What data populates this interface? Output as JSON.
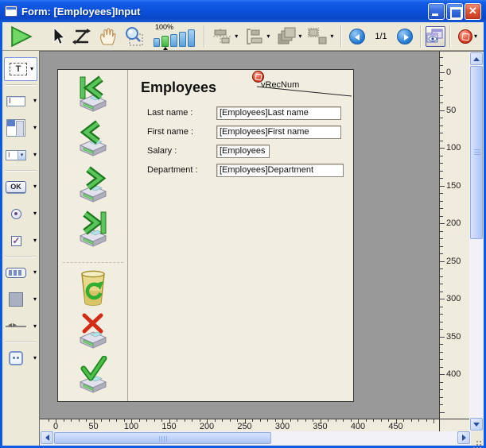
{
  "window": {
    "title": "Form: [Employees]Input"
  },
  "titlebar": {
    "buttons": [
      "minimize",
      "maximize",
      "close"
    ]
  },
  "toolbar": {
    "zoom_value": "100%",
    "page_indicator": "1/1",
    "tools": [
      "execute-form",
      "pointer",
      "entry-order",
      "move",
      "zoom",
      "zoom-scale",
      "align",
      "distribute",
      "move-level",
      "resize",
      "previous-page",
      "next-page",
      "preview",
      "insert-fields"
    ]
  },
  "sidebar": {
    "tools": [
      {
        "name": "text",
        "glyph": "T",
        "active": true
      },
      {
        "name": "input"
      },
      {
        "name": "list-box"
      },
      {
        "name": "combo-box"
      },
      {
        "name": "button",
        "glyph": "OK"
      },
      {
        "name": "radio-button"
      },
      {
        "name": "check-box"
      },
      {
        "name": "button-grid"
      },
      {
        "name": "rectangle"
      },
      {
        "name": "splitter"
      },
      {
        "name": "plugin-area"
      }
    ]
  },
  "form": {
    "title": "Employees",
    "record_variable": "vRecNum",
    "fields": [
      {
        "label": "Last name :",
        "value": "[Employees]Last name"
      },
      {
        "label": "First name :",
        "value": "[Employees]First name"
      },
      {
        "label": "Salary :",
        "value": "[Employees"
      },
      {
        "label": "Department :",
        "value": "[Employees]Department"
      }
    ],
    "nav_buttons": [
      "first-record",
      "previous-record",
      "next-record",
      "last-record",
      "delete-record",
      "cancel-record",
      "accept-record"
    ]
  },
  "rulers": {
    "horizontal_labels": [
      0,
      50,
      100,
      150,
      200,
      250,
      300,
      350,
      400,
      450
    ],
    "vertical_labels": [
      0,
      50,
      100,
      150,
      200,
      250,
      300,
      350,
      400
    ]
  },
  "colors": {
    "titlebar_blue": "#0c59e8",
    "toolbar_beige": "#ece9d8",
    "canvas_grey": "#999999",
    "page_cream": "#f1eee1",
    "accent_green": "#3cb53c",
    "badge_red": "#e1452c"
  }
}
